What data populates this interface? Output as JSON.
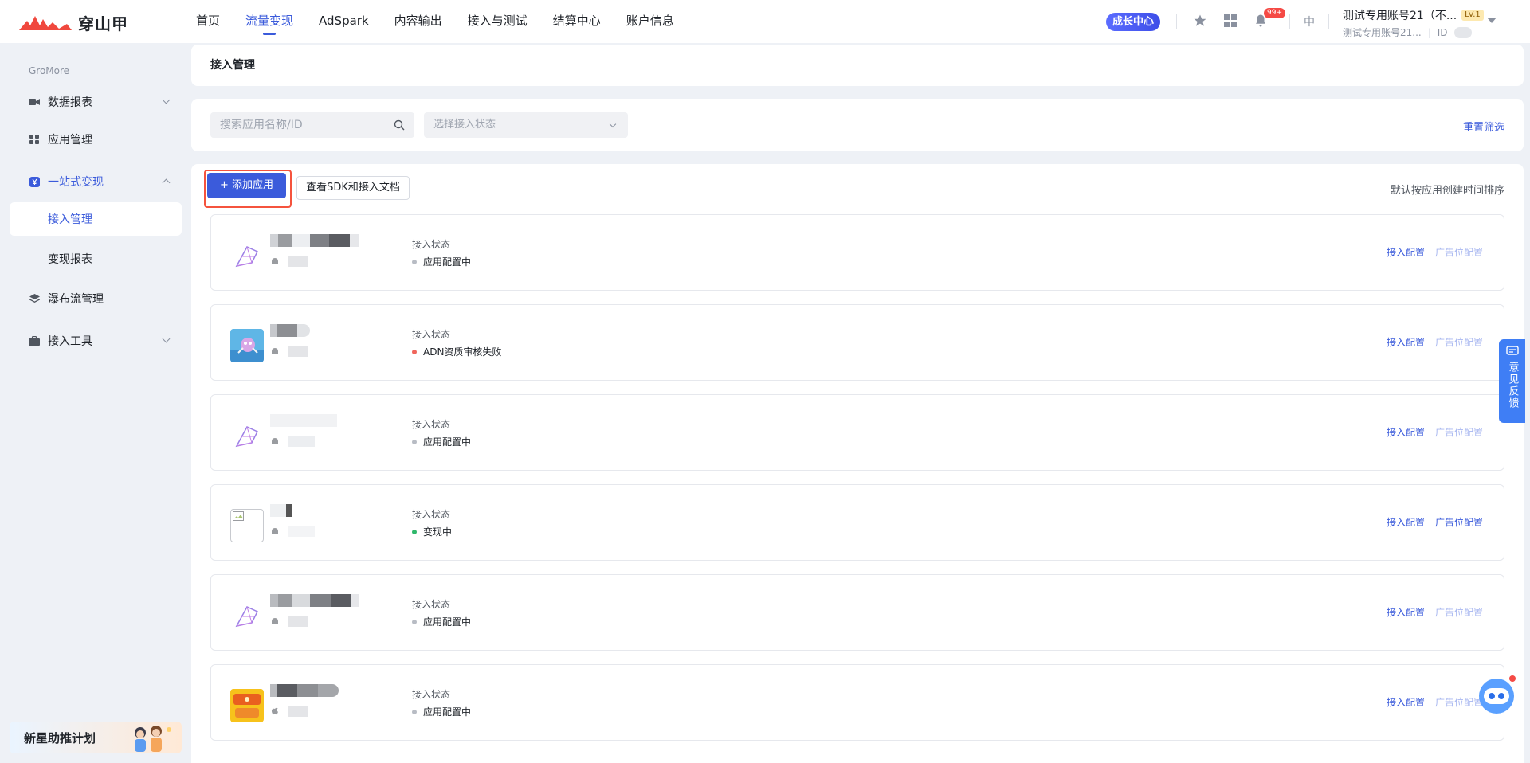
{
  "header": {
    "logo_text": "穿山甲",
    "nav": [
      "首页",
      "流量变现",
      "AdSpark",
      "内容输出",
      "接入与测试",
      "结算中心",
      "账户信息"
    ],
    "nav_active_index": 1,
    "growth_center": "成长中心",
    "notification_badge": "99+",
    "language": "中",
    "account_name": "测试专用账号21（不...",
    "account_level": "LV.1",
    "account_sub": "测试专用账号21...",
    "account_id_label": "ID"
  },
  "sidebar": {
    "section_label": "GroMore",
    "items": [
      {
        "label": "数据报表",
        "icon": "video-icon",
        "expandable": true
      },
      {
        "label": "应用管理",
        "icon": "grid-icon",
        "expandable": false
      },
      {
        "label": "一站式变现",
        "icon": "yen-icon",
        "expandable": true,
        "open": true
      },
      {
        "label": "瀑布流管理",
        "icon": "layers-icon",
        "expandable": false
      },
      {
        "label": "接入工具",
        "icon": "toolbox-icon",
        "expandable": true
      }
    ],
    "subitems": [
      {
        "label": "接入管理",
        "active": true
      },
      {
        "label": "变现报表",
        "active": false
      }
    ],
    "promo": "新星助推计划"
  },
  "breadcrumb": {
    "title": "接入管理"
  },
  "filters": {
    "search_placeholder": "搜索应用名称/ID",
    "status_placeholder": "选择接入状态",
    "reset": "重置筛选"
  },
  "toolbar": {
    "add_app": "+ 添加应用",
    "sdk_docs": "查看SDK和接入文档",
    "sort_note": "默认按应用创建时间排序"
  },
  "apps": [
    {
      "status_label": "接入状态",
      "status": "应用配置中",
      "status_color": "#b8bcc4",
      "platform": "android",
      "action_config": "接入配置",
      "action_ad": "广告位配置",
      "ad_enabled": false
    },
    {
      "status_label": "接入状态",
      "status": "ADN资质审核失败",
      "status_color": "#f0655b",
      "platform": "android",
      "action_config": "接入配置",
      "action_ad": "广告位配置",
      "ad_enabled": false
    },
    {
      "status_label": "接入状态",
      "status": "应用配置中",
      "status_color": "#b8bcc4",
      "platform": "android",
      "action_config": "接入配置",
      "action_ad": "广告位配置",
      "ad_enabled": false
    },
    {
      "status_label": "接入状态",
      "status": "变现中",
      "status_color": "#2fb86b",
      "platform": "android",
      "action_config": "接入配置",
      "action_ad": "广告位配置",
      "ad_enabled": true
    },
    {
      "status_label": "接入状态",
      "status": "应用配置中",
      "status_color": "#b8bcc4",
      "platform": "android",
      "action_config": "接入配置",
      "action_ad": "广告位配置",
      "ad_enabled": false
    },
    {
      "status_label": "接入状态",
      "status": "应用配置中",
      "status_color": "#b8bcc4",
      "platform": "ios",
      "action_config": "接入配置",
      "action_ad": "广告位配置",
      "ad_enabled": false
    }
  ],
  "feedback": {
    "label": "意见反馈"
  },
  "colors": {
    "accent": "#3b5bdb",
    "highlight_border": "#f5533d"
  }
}
